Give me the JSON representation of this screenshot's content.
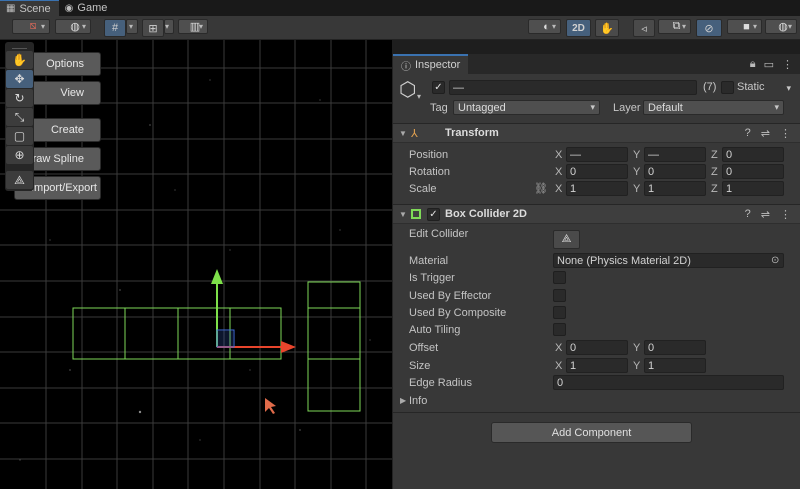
{
  "tabs": [
    {
      "label": "Scene",
      "icon": "scene-icon",
      "active": true
    },
    {
      "label": "Game",
      "icon": "game-icon",
      "active": false
    }
  ],
  "scene_toolbar": {
    "mode_2d_label": "2D"
  },
  "overlay_buttons": {
    "options": "Options",
    "view": "View",
    "create": "Create",
    "draw_spline": "Draw Spline",
    "import_export": "Import/Export"
  },
  "inspector": {
    "tab_label": "Inspector",
    "object_name": "—",
    "object_count": "(7)",
    "static_label": "Static",
    "tag_label": "Tag",
    "tag_value": "Untagged",
    "layer_label": "Layer",
    "layer_value": "Default",
    "transform": {
      "title": "Transform",
      "position_label": "Position",
      "position": {
        "x": "—",
        "y": "—",
        "z": "0"
      },
      "rotation_label": "Rotation",
      "rotation": {
        "x": "0",
        "y": "0",
        "z": "0"
      },
      "scale_label": "Scale",
      "scale": {
        "x": "1",
        "y": "1",
        "z": "1"
      },
      "axis_x": "X",
      "axis_y": "Y",
      "axis_z": "Z"
    },
    "box_collider": {
      "title": "Box Collider 2D",
      "edit_collider_label": "Edit Collider",
      "material_label": "Material",
      "material_value": "None (Physics Material 2D)",
      "is_trigger_label": "Is Trigger",
      "used_by_effector_label": "Used By Effector",
      "used_by_composite_label": "Used By Composite",
      "auto_tiling_label": "Auto Tiling",
      "offset_label": "Offset",
      "offset": {
        "x": "0",
        "y": "0"
      },
      "size_label": "Size",
      "size": {
        "x": "1",
        "y": "1"
      },
      "edge_radius_label": "Edge Radius",
      "edge_radius_value": "0",
      "info_label": "Info"
    },
    "add_component_label": "Add Component"
  },
  "colors": {
    "accent": "#3a72b0",
    "collider_green": "#7ed957",
    "gizmo_red": "#e8452c",
    "gizmo_green": "#7ee04a",
    "gizmo_blue": "#3f6ee0"
  }
}
